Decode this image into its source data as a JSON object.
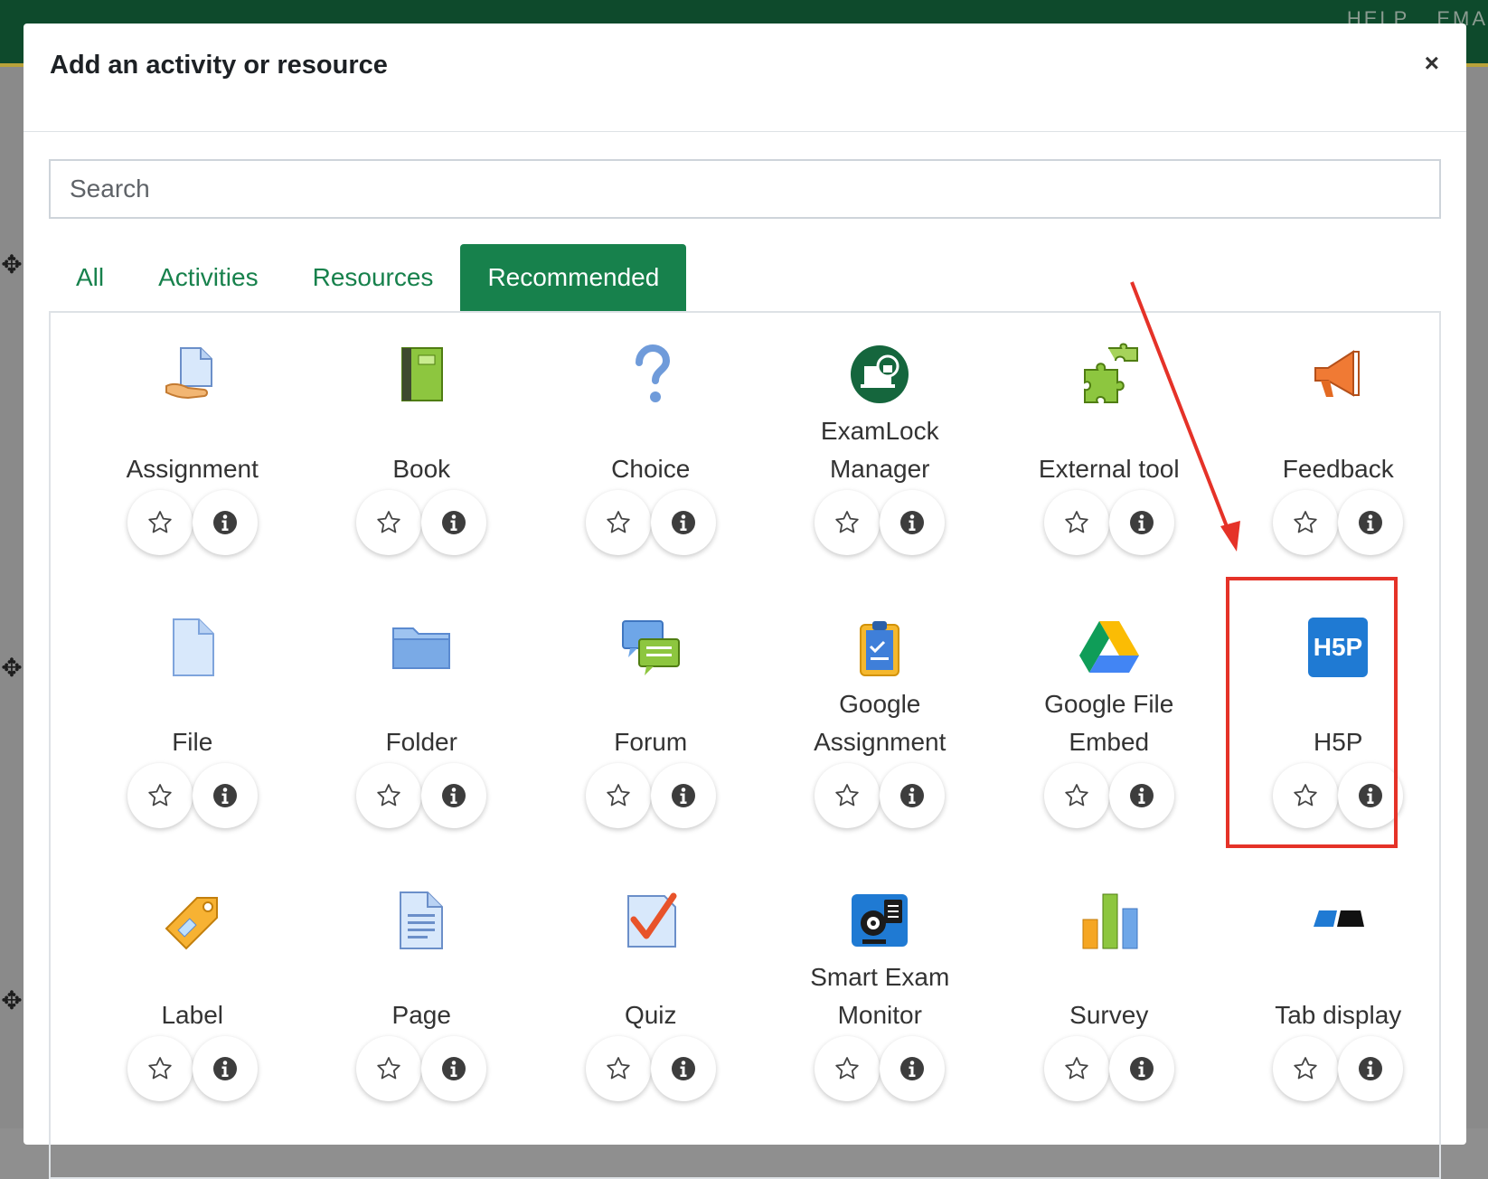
{
  "topbar": {
    "links": [
      "HELP",
      "EMA"
    ]
  },
  "modal": {
    "title": "Add an activity or resource",
    "close_label": "×"
  },
  "search": {
    "placeholder": "Search",
    "value": ""
  },
  "tabs": [
    {
      "label": "All",
      "active": false
    },
    {
      "label": "Activities",
      "active": false
    },
    {
      "label": "Resources",
      "active": false
    },
    {
      "label": "Recommended",
      "active": true
    }
  ],
  "items": [
    {
      "label": "Assignment",
      "icon": "assignment-icon"
    },
    {
      "label": "Book",
      "icon": "book-icon"
    },
    {
      "label": "Choice",
      "icon": "choice-icon"
    },
    {
      "label": "ExamLock Manager",
      "icon": "examlock-icon"
    },
    {
      "label": "External tool",
      "icon": "puzzle-icon"
    },
    {
      "label": "Feedback",
      "icon": "megaphone-icon"
    },
    {
      "label": "File",
      "icon": "file-icon"
    },
    {
      "label": "Folder",
      "icon": "folder-icon"
    },
    {
      "label": "Forum",
      "icon": "forum-icon"
    },
    {
      "label": "Google Assignment",
      "icon": "clipboard-icon"
    },
    {
      "label": "Google File Embed",
      "icon": "google-drive-icon"
    },
    {
      "label": "H5P",
      "icon": "h5p-icon"
    },
    {
      "label": "Label",
      "icon": "label-tag-icon"
    },
    {
      "label": "Page",
      "icon": "page-icon"
    },
    {
      "label": "Quiz",
      "icon": "quiz-icon"
    },
    {
      "label": "Smart Exam Monitor",
      "icon": "webcam-icon"
    },
    {
      "label": "Survey",
      "icon": "bar-chart-icon"
    },
    {
      "label": "Tab display",
      "icon": "tab-display-icon"
    }
  ],
  "colors": {
    "accent": "#17814c",
    "annotation": "#e53228",
    "topbar": "#0e4a2c"
  }
}
